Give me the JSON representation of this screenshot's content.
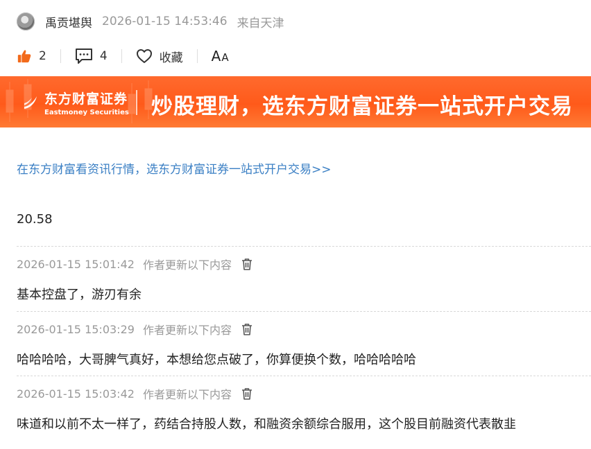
{
  "author": {
    "name": "禹贡堪舆",
    "time": "2026-01-15 14:53:46",
    "location": "来自天津"
  },
  "actions": {
    "like_count": "2",
    "comment_count": "4",
    "favorite_label": "收藏",
    "font_large": "A",
    "font_small": "A"
  },
  "banner": {
    "logo_cn": "东方财富证券",
    "logo_en": "Eastmoney Securities",
    "slogan": "炒股理财，选东方财富证券一站式开户交易",
    "color": "#ff5a1a"
  },
  "promo_link": "在东方财富看资讯行情，选东方财富证券一站式开户交易>>",
  "post_value": "20.58",
  "updates": [
    {
      "time": "2026-01-15 15:01:42",
      "label": "作者更新以下内容",
      "text": "基本控盘了，游刃有余"
    },
    {
      "time": "2026-01-15 15:03:29",
      "label": "作者更新以下内容",
      "text": "哈哈哈哈，大哥脾气真好，本想给您点破了，你算便换个数，哈哈哈哈哈"
    },
    {
      "time": "2026-01-15 15:03:42",
      "label": "作者更新以下内容",
      "text": "味道和以前不太一样了，药结合持股人数，和融资余额综合服用，这个股目前融资代表散韭"
    }
  ],
  "colors": {
    "accent_like": "#f26a1b",
    "link": "#3a7fc4",
    "muted": "#999999"
  }
}
